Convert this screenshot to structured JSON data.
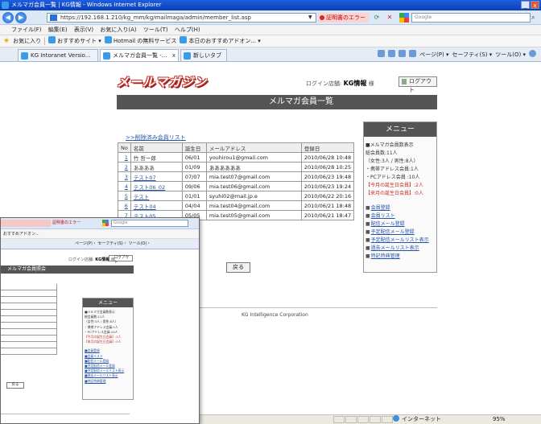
{
  "window": {
    "title": "メルマガ会員一覧 | KG情報 - Windows Internet Explorer",
    "minimize": "_",
    "close": "x",
    "address_url": "https://192.168.1.210/kg_mm/kg/mailmaga/admin/member_list.asp",
    "cert_error": "証明書のエラー",
    "search_placeholder": "Google"
  },
  "menu": [
    "ファイル(F)",
    "編集(E)",
    "表示(V)",
    "お気に入り(A)",
    "ツール(T)",
    "ヘルプ(H)"
  ],
  "favorites": {
    "label": "お気に入り",
    "links": [
      "おすすめサイト ▾",
      "Hotmail の無料サービス",
      "本日のおすすめアドオン... ▾"
    ]
  },
  "tabs": [
    {
      "label": "KG Intoranet Versio..."
    },
    {
      "label": "メルマガ会員一覧 -..."
    },
    {
      "label": "新しいタブ"
    }
  ],
  "tab_close": "x",
  "toolbar_right": [
    "ページ(P) ▾",
    "セーフティ(S) ▾",
    "ツール(O) ▾"
  ],
  "page": {
    "logo": "メールマガジン",
    "login_label": "ログイン店舗:",
    "login_store": "KG情報",
    "login_suffix": "様",
    "logout": "ログアウト",
    "title": "メルマガ会員一覧",
    "back_link": ">>削除済み会員リスト",
    "back_button": "戻る",
    "footer": "KG Intelligence Corporation"
  },
  "table": {
    "headers": [
      "No",
      "名前",
      "誕生日",
      "メールアドレス",
      "登録日"
    ],
    "rows": [
      {
        "no": "1",
        "name": "竹 哲一郎",
        "birthday": "06/01",
        "email": "youhirou1@gmail.com",
        "date": "2010/06/28 10:48"
      },
      {
        "no": "2",
        "name": "ああああ",
        "birthday": "01/09",
        "email": "ああああああ",
        "date": "2010/06/28 10:25"
      },
      {
        "no": "3",
        "name": "テスト07",
        "birthday": "07/07",
        "email": "mia.test07@gmail.com",
        "date": "2010/06/23 19:48"
      },
      {
        "no": "4",
        "name": "テスト06_02",
        "birthday": "09/06",
        "email": "mia.test06@gmail.com",
        "date": "2010/06/23 19:24"
      },
      {
        "no": "5",
        "name": "テスト",
        "birthday": "01/01",
        "email": "syuhi02@mail.jp.e",
        "date": "2010/06/22 20:16"
      },
      {
        "no": "6",
        "name": "テスト04",
        "birthday": "04/04",
        "email": "mia.test04@gmail.com",
        "date": "2010/06/21 18:48"
      },
      {
        "no": "7",
        "name": "テスト05",
        "birthday": "05/05",
        "email": "mia.test05@gmail.com",
        "date": "2010/06/21 18:47"
      }
    ]
  },
  "side": {
    "header": "メニュー",
    "stats": [
      {
        "text": "■メルマガ会員数表示",
        "red": false
      },
      {
        "text": "総会員数:11人",
        "red": false
      },
      {
        "text": "（女性:3人 / 男性:8人）",
        "red": false
      },
      {
        "text": "・携帯アドレス会員:1人",
        "red": false
      },
      {
        "text": "・PCアドレス会員 :10人",
        "red": false
      },
      {
        "text": "【今月の誕生日会員】:2人",
        "red": true
      },
      {
        "text": "【来月の誕生日会員】:0人",
        "red": true
      }
    ],
    "links": [
      "会員登録",
      "会員リスト",
      "配信メール登録",
      "予定配信メール登録",
      "予定配信メールリスト表示",
      "過去メールリスト表示",
      "特記特典管理"
    ]
  },
  "status": {
    "zone": "インターネット",
    "zoom": "95%"
  },
  "mini": {
    "cert_error": "証明書のエラー",
    "search_placeholder": "Google",
    "fav_text": "おすすめアドオン...",
    "tools_text": "ページ(P)・ セーフティ(S)・ ツール(O)・",
    "login_label": "ログイン店舗:",
    "login_store": "KG情報",
    "login_suffix": "様",
    "logout": "ログアウト",
    "title": "メルマガ会員照会",
    "back_button": "戻る",
    "side_header": "メニュー",
    "side_stats": [
      {
        "text": "■メルマガ会員数表示",
        "red": false
      },
      {
        "text": "総会員数:11人",
        "red": false
      },
      {
        "text": "（女性:3人 / 男性:8人）",
        "red": false
      },
      {
        "text": "・携帯アドレス会員:1人",
        "red": false
      },
      {
        "text": "・PCアドレス会員:10人",
        "red": false
      },
      {
        "text": "【今月の誕生日会員】:2人",
        "red": true
      },
      {
        "text": "【来月の誕生日会員】:0人",
        "red": true
      }
    ],
    "side_links": [
      "■会員登録",
      "■会員リスト",
      "■配信メール登録",
      "■予定配信メール登録",
      "■予定配信メールリスト表示",
      "■過去メールリスト表示",
      "■特記特典管理"
    ]
  }
}
